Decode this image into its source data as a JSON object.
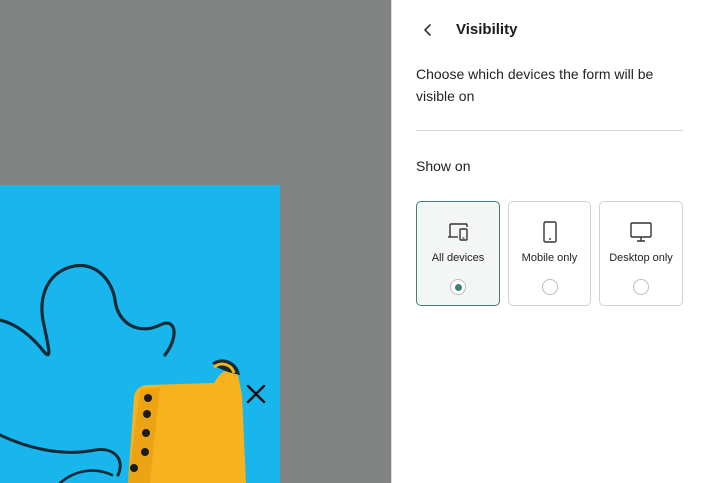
{
  "colors": {
    "preview_bg": "#808381",
    "popup_bg": "#19b6ee",
    "accent": "#3e7f78",
    "boot": "#f6b31e"
  },
  "popup": {
    "close_icon": "close-icon"
  },
  "panel": {
    "back_icon": "chevron-left-icon",
    "title": "Visibility",
    "description": "Choose which devices the form will be visible on",
    "show_on_label": "Show on",
    "options": [
      {
        "label": "All devices",
        "icon": "all-devices-icon",
        "selected": true
      },
      {
        "label": "Mobile only",
        "icon": "mobile-icon",
        "selected": false
      },
      {
        "label": "Desktop only",
        "icon": "desktop-icon",
        "selected": false
      }
    ]
  }
}
